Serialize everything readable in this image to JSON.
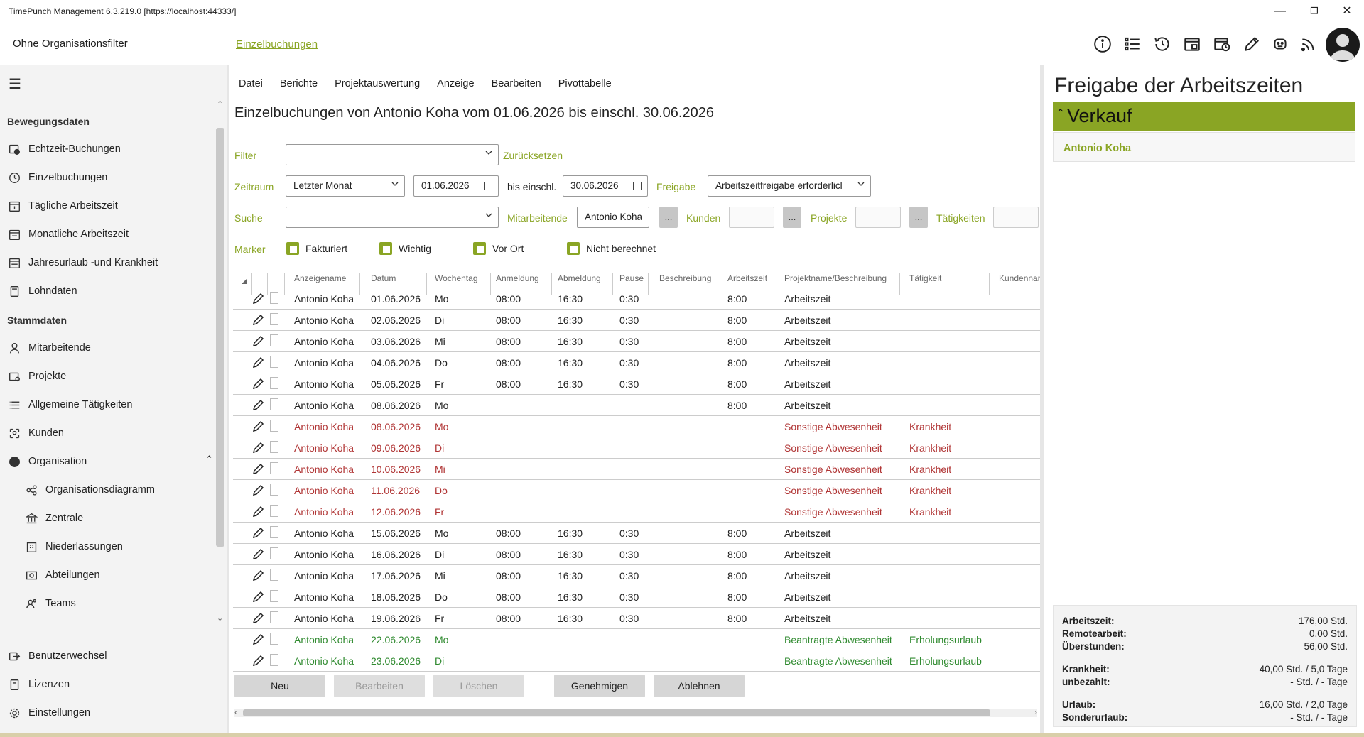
{
  "window": {
    "title": "TimePunch Management 6.3.219.0 [https://localhost:44333/]"
  },
  "topbar": {
    "org_filter": "Ohne Organisationsfilter",
    "breadcrumb": "Einzelbuchungen"
  },
  "sidebar": {
    "sections": {
      "bewegungsdaten": "Bewegungsdaten",
      "stammdaten": "Stammdaten"
    },
    "bewegungsdaten": [
      {
        "label": "Echtzeit-Buchungen",
        "icon": "realtime-icon"
      },
      {
        "label": "Einzelbuchungen",
        "icon": "clock-icon"
      },
      {
        "label": "Tägliche Arbeitszeit",
        "icon": "calendar-day-icon"
      },
      {
        "label": "Monatliche Arbeitszeit",
        "icon": "calendar-month-icon"
      },
      {
        "label": "Jahresurlaub -und Krankheit",
        "icon": "calendar-year-icon"
      },
      {
        "label": "Lohndaten",
        "icon": "calculator-icon"
      }
    ],
    "stammdaten": [
      {
        "label": "Mitarbeitende",
        "icon": "person-icon"
      },
      {
        "label": "Projekte",
        "icon": "projects-icon"
      },
      {
        "label": "Allgemeine Tätigkeiten",
        "icon": "list-icon"
      },
      {
        "label": "Kunden",
        "icon": "customers-icon"
      },
      {
        "label": "Organisation",
        "icon": "globe-icon"
      }
    ],
    "organisation": [
      {
        "label": "Organisationsdiagramm",
        "icon": "org-chart-icon"
      },
      {
        "label": "Zentrale",
        "icon": "bank-icon"
      },
      {
        "label": "Niederlassungen",
        "icon": "branch-icon"
      },
      {
        "label": "Abteilungen",
        "icon": "department-icon"
      },
      {
        "label": "Teams",
        "icon": "team-icon"
      }
    ],
    "bottom": [
      {
        "label": "Benutzerwechsel",
        "icon": "switch-user-icon"
      },
      {
        "label": "Lizenzen",
        "icon": "license-icon"
      },
      {
        "label": "Einstellungen",
        "icon": "gear-icon"
      }
    ]
  },
  "menu": [
    "Datei",
    "Berichte",
    "Projektauswertung",
    "Anzeige",
    "Bearbeiten",
    "Pivottabelle"
  ],
  "page": {
    "title": "Einzelbuchungen von Antonio Koha vom 01.06.2026 bis einschl. 30.06.2026"
  },
  "filters": {
    "filter_label": "Filter",
    "filter_value": "",
    "reset": "Zurücksetzen",
    "zeitraum_label": "Zeitraum",
    "zeitraum_value": "Letzter Monat",
    "date_from": "01.06.2026",
    "bis_label": "bis einschl.",
    "date_to": "30.06.2026",
    "freigabe_label": "Freigabe",
    "freigabe_value": "Arbeitszeitfreigabe erforderlicl",
    "suche_label": "Suche",
    "suche_value": "",
    "mitarbeitende_label": "Mitarbeitende",
    "mitarbeitende_value": "Antonio Koha",
    "kunden_label": "Kunden",
    "projekte_label": "Projekte",
    "taetigkeiten_label": "Tätigkeiten",
    "dots": "...",
    "marker_label": "Marker",
    "markers": [
      "Fakturiert",
      "Wichtig",
      "Vor Ort",
      "Nicht berechnet"
    ]
  },
  "table": {
    "columns": [
      "Anzeigename",
      "Datum",
      "Wochentag",
      "Anmeldung",
      "Abmeldung",
      "Pause",
      "Beschreibung",
      "Arbeitszeit",
      "Projektname/Beschreibung",
      "Tätigkeit",
      "Kundennan"
    ],
    "rows": [
      {
        "name": "Antonio Koha",
        "date": "01.06.2026",
        "day": "Mo",
        "in": "08:00",
        "out": "16:30",
        "pause": "0:30",
        "desc": "",
        "work": "8:00",
        "project": "Arbeitszeit",
        "task": "",
        "status": "normal"
      },
      {
        "name": "Antonio Koha",
        "date": "02.06.2026",
        "day": "Di",
        "in": "08:00",
        "out": "16:30",
        "pause": "0:30",
        "desc": "",
        "work": "8:00",
        "project": "Arbeitszeit",
        "task": "",
        "status": "normal"
      },
      {
        "name": "Antonio Koha",
        "date": "03.06.2026",
        "day": "Mi",
        "in": "08:00",
        "out": "16:30",
        "pause": "0:30",
        "desc": "",
        "work": "8:00",
        "project": "Arbeitszeit",
        "task": "",
        "status": "normal"
      },
      {
        "name": "Antonio Koha",
        "date": "04.06.2026",
        "day": "Do",
        "in": "08:00",
        "out": "16:30",
        "pause": "0:30",
        "desc": "",
        "work": "8:00",
        "project": "Arbeitszeit",
        "task": "",
        "status": "normal"
      },
      {
        "name": "Antonio Koha",
        "date": "05.06.2026",
        "day": "Fr",
        "in": "08:00",
        "out": "16:30",
        "pause": "0:30",
        "desc": "",
        "work": "8:00",
        "project": "Arbeitszeit",
        "task": "",
        "status": "normal"
      },
      {
        "name": "Antonio Koha",
        "date": "08.06.2026",
        "day": "Mo",
        "in": "",
        "out": "",
        "pause": "",
        "desc": "",
        "work": "8:00",
        "project": "Arbeitszeit",
        "task": "",
        "status": "normal"
      },
      {
        "name": "Antonio Koha",
        "date": "08.06.2026",
        "day": "Mo",
        "in": "",
        "out": "",
        "pause": "",
        "desc": "",
        "work": "",
        "project": "Sonstige Abwesenheit",
        "task": "Krankheit",
        "status": "red"
      },
      {
        "name": "Antonio Koha",
        "date": "09.06.2026",
        "day": "Di",
        "in": "",
        "out": "",
        "pause": "",
        "desc": "",
        "work": "",
        "project": "Sonstige Abwesenheit",
        "task": "Krankheit",
        "status": "red"
      },
      {
        "name": "Antonio Koha",
        "date": "10.06.2026",
        "day": "Mi",
        "in": "",
        "out": "",
        "pause": "",
        "desc": "",
        "work": "",
        "project": "Sonstige Abwesenheit",
        "task": "Krankheit",
        "status": "red"
      },
      {
        "name": "Antonio Koha",
        "date": "11.06.2026",
        "day": "Do",
        "in": "",
        "out": "",
        "pause": "",
        "desc": "",
        "work": "",
        "project": "Sonstige Abwesenheit",
        "task": "Krankheit",
        "status": "red"
      },
      {
        "name": "Antonio Koha",
        "date": "12.06.2026",
        "day": "Fr",
        "in": "",
        "out": "",
        "pause": "",
        "desc": "",
        "work": "",
        "project": "Sonstige Abwesenheit",
        "task": "Krankheit",
        "status": "red"
      },
      {
        "name": "Antonio Koha",
        "date": "15.06.2026",
        "day": "Mo",
        "in": "08:00",
        "out": "16:30",
        "pause": "0:30",
        "desc": "",
        "work": "8:00",
        "project": "Arbeitszeit",
        "task": "",
        "status": "normal"
      },
      {
        "name": "Antonio Koha",
        "date": "16.06.2026",
        "day": "Di",
        "in": "08:00",
        "out": "16:30",
        "pause": "0:30",
        "desc": "",
        "work": "8:00",
        "project": "Arbeitszeit",
        "task": "",
        "status": "normal"
      },
      {
        "name": "Antonio Koha",
        "date": "17.06.2026",
        "day": "Mi",
        "in": "08:00",
        "out": "16:30",
        "pause": "0:30",
        "desc": "",
        "work": "8:00",
        "project": "Arbeitszeit",
        "task": "",
        "status": "normal"
      },
      {
        "name": "Antonio Koha",
        "date": "18.06.2026",
        "day": "Do",
        "in": "08:00",
        "out": "16:30",
        "pause": "0:30",
        "desc": "",
        "work": "8:00",
        "project": "Arbeitszeit",
        "task": "",
        "status": "normal"
      },
      {
        "name": "Antonio Koha",
        "date": "19.06.2026",
        "day": "Fr",
        "in": "08:00",
        "out": "16:30",
        "pause": "0:30",
        "desc": "",
        "work": "8:00",
        "project": "Arbeitszeit",
        "task": "",
        "status": "normal"
      },
      {
        "name": "Antonio Koha",
        "date": "22.06.2026",
        "day": "Mo",
        "in": "",
        "out": "",
        "pause": "",
        "desc": "",
        "work": "",
        "project": "Beantragte Abwesenheit",
        "task": "Erholungsurlaub",
        "status": "green"
      },
      {
        "name": "Antonio Koha",
        "date": "23.06.2026",
        "day": "Di",
        "in": "",
        "out": "",
        "pause": "",
        "desc": "",
        "work": "",
        "project": "Beantragte Abwesenheit",
        "task": "Erholungsurlaub",
        "status": "green"
      }
    ]
  },
  "buttons": {
    "neu": "Neu",
    "bearbeiten": "Bearbeiten",
    "loeschen": "Löschen",
    "genehmigen": "Genehmigen",
    "ablehnen": "Ablehnen"
  },
  "approval": {
    "title": "Freigabe der Arbeitszeiten",
    "group": "Verkauf",
    "member": "Antonio Koha",
    "stats": [
      {
        "label": "Arbeitszeit:",
        "value": "176,00 Std."
      },
      {
        "label": "Remotearbeit:",
        "value": "0,00 Std."
      },
      {
        "label": "Überstunden:",
        "value": "56,00 Std."
      },
      {
        "label": "Krankheit:",
        "value": "40,00 Std. / 5,0 Tage"
      },
      {
        "label": "unbezahlt:",
        "value": "- Std. / - Tage"
      },
      {
        "label": "Urlaub:",
        "value": "16,00 Std. / 2,0 Tage"
      },
      {
        "label": "Sonderurlaub:",
        "value": "- Std. / - Tage"
      }
    ]
  },
  "colors": {
    "accent": "#8aa524",
    "absence_red": "#b03434",
    "requested_green": "#2f8a2f"
  }
}
